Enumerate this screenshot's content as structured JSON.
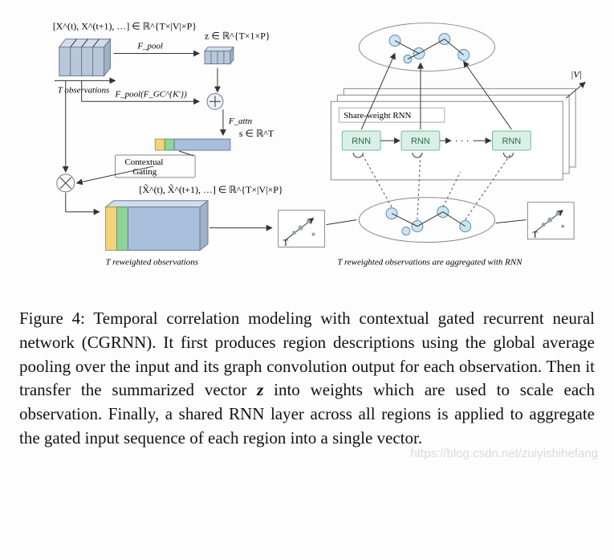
{
  "figure": {
    "top_label": "[X^(t), X^(t+1), …] ∈ ℝ^{T×|V|×P}",
    "z_label": "z ∈ ℝ^{T×1×P}",
    "pool1": "F_pool",
    "pool2": "F_pool(F_GC^{K'})",
    "t_obs": "T observations",
    "fattn": "F_attn",
    "s_label": "s ∈ ℝ^T",
    "gating": "Contextual Gating",
    "xtilde_label": "[X̃^(t), X̃^(t+1), …] ∈ ℝ^{T×|V|×P}",
    "t_reweighted": "T reweighted observations",
    "rnn_panel_title": "Share-weight RNN",
    "rnn_block": "RNN",
    "dots": "· · ·",
    "v_card": "|V|",
    "t_arrow": "T",
    "right_caption": "T reweighted observations are aggregated with RNN"
  },
  "caption": {
    "label": "Figure 4:",
    "text1": "Temporal correlation modeling with contextual gated recurrent neural network (CGRNN). It first produces region descriptions using the global average pooling over the input and its graph convolution output for each observation. Then it transfer the summarized vector ",
    "z": "z",
    "text2": " into weights which are used to scale each observation. Finally, a shared RNN layer across all regions is applied to aggregate the gated input sequence of each region into a single vector."
  },
  "watermark": "https://blog.csdn.net/zuiyishihefang"
}
